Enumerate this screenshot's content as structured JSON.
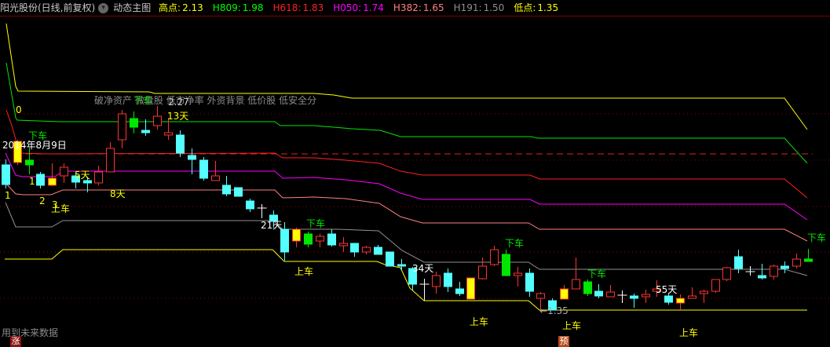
{
  "header": {
    "stock_title": "阳光股份(日线,前复权)",
    "indicator_name": "动态主图",
    "dropdown_icon": "chevron-down-icon",
    "levels": [
      {
        "label": "高点:",
        "value": "2.13",
        "color": "#ffff00"
      },
      {
        "label": "H809:",
        "value": "1.98",
        "color": "#00ff00"
      },
      {
        "label": "H618:",
        "value": "1.83",
        "color": "#ff2020"
      },
      {
        "label": "H050:",
        "value": "1.74",
        "color": "#ff00ff"
      },
      {
        "label": "H382:",
        "value": "1.65",
        "color": "#ff8080"
      },
      {
        "label": "H191:",
        "value": "1.50",
        "color": "#909090"
      },
      {
        "label": "低点:",
        "value": "1.35",
        "color": "#ffff00"
      }
    ]
  },
  "chart_data": {
    "type": "candlestick",
    "high": 2.13,
    "low": 1.35,
    "candles": [
      [
        "down",
        1.905,
        1.83,
        1.926,
        1.815
      ],
      [
        "yellow",
        1.914,
        1.995,
        2.001,
        1.905
      ],
      [
        "green",
        1.923,
        1.905,
        1.971,
        1.869
      ],
      [
        "down",
        1.869,
        1.827,
        1.878,
        1.815
      ],
      [
        "yellow",
        1.827,
        1.854,
        1.911,
        1.824
      ],
      [
        "up",
        1.863,
        1.896,
        1.911,
        1.836
      ],
      [
        "down",
        1.863,
        1.839,
        1.875,
        1.815
      ],
      [
        "down",
        1.845,
        1.836,
        1.86,
        1.8
      ],
      [
        "up",
        1.836,
        1.878,
        1.902,
        1.827
      ],
      [
        "up",
        1.878,
        1.968,
        1.992,
        1.878
      ],
      [
        "up",
        2.001,
        2.1,
        2.115,
        1.968
      ],
      [
        "green",
        2.082,
        2.049,
        2.109,
        2.025
      ],
      [
        "down",
        2.037,
        2.028,
        2.079,
        2.016
      ],
      [
        "up",
        2.055,
        2.091,
        2.13,
        2.04
      ],
      [
        "up",
        2.019,
        2.028,
        2.085,
        2.001
      ],
      [
        "down",
        2.019,
        1.95,
        2.037,
        1.935
      ],
      [
        "down",
        1.941,
        1.926,
        1.968,
        1.869
      ],
      [
        "down",
        1.923,
        1.854,
        1.935,
        1.845
      ],
      [
        "up",
        1.845,
        1.863,
        1.92,
        1.845
      ],
      [
        "down",
        1.827,
        1.794,
        1.863,
        1.785
      ],
      [
        "down",
        1.818,
        1.785,
        1.818,
        1.785
      ],
      [
        "down",
        1.767,
        1.737,
        1.776,
        1.725
      ],
      [
        "cross",
        1.74,
        1.74,
        1.755,
        1.701
      ],
      [
        "down",
        1.713,
        1.689,
        1.731,
        1.665
      ],
      [
        "down",
        1.659,
        1.572,
        1.686,
        1.539
      ],
      [
        "yellow",
        1.614,
        1.659,
        1.665,
        1.59
      ],
      [
        "green",
        1.641,
        1.602,
        1.65,
        1.59
      ],
      [
        "up",
        1.614,
        1.632,
        1.641,
        1.59
      ],
      [
        "down",
        1.641,
        1.599,
        1.659,
        1.593
      ],
      [
        "up",
        1.596,
        1.605,
        1.629,
        1.572
      ],
      [
        "down",
        1.605,
        1.572,
        1.605,
        1.554
      ],
      [
        "up",
        1.572,
        1.59,
        1.596,
        1.563
      ],
      [
        "down",
        1.59,
        1.563,
        1.599,
        1.563
      ],
      [
        "down",
        1.572,
        1.518,
        1.572,
        1.518
      ],
      [
        "down",
        1.524,
        1.518,
        1.545,
        1.5
      ],
      [
        "down",
        1.509,
        1.449,
        1.515,
        1.425
      ],
      [
        "cross",
        1.449,
        1.449,
        1.47,
        1.386
      ],
      [
        "up",
        1.44,
        1.482,
        1.497,
        1.413
      ],
      [
        "down",
        1.491,
        1.44,
        1.509,
        1.419
      ],
      [
        "down",
        1.431,
        1.413,
        1.458,
        1.404
      ],
      [
        "yellow",
        1.392,
        1.473,
        1.473,
        1.392
      ],
      [
        "up",
        1.47,
        1.518,
        1.551,
        1.467
      ],
      [
        "up",
        1.524,
        1.581,
        1.596,
        1.518
      ],
      [
        "green",
        1.563,
        1.482,
        1.581,
        1.479
      ],
      [
        "up",
        1.482,
        1.491,
        1.515,
        1.44
      ],
      [
        "down",
        1.491,
        1.422,
        1.509,
        1.401
      ],
      [
        "up",
        1.395,
        1.413,
        1.419,
        1.35
      ],
      [
        "down",
        1.386,
        1.35,
        1.395,
        1.35
      ],
      [
        "yellow",
        1.392,
        1.431,
        1.446,
        1.392
      ],
      [
        "up",
        1.431,
        1.467,
        1.551,
        1.431
      ],
      [
        "green",
        1.458,
        1.413,
        1.467,
        1.404
      ],
      [
        "down",
        1.422,
        1.404,
        1.449,
        1.395
      ],
      [
        "up",
        1.401,
        1.419,
        1.446,
        1.401
      ],
      [
        "cross",
        1.407,
        1.407,
        1.425,
        1.377
      ],
      [
        "down",
        1.404,
        1.395,
        1.413,
        1.359
      ],
      [
        "up",
        1.401,
        1.41,
        1.428,
        1.377
      ],
      [
        "up",
        1.422,
        1.431,
        1.464,
        1.401
      ],
      [
        "down",
        1.404,
        1.38,
        1.413,
        1.371
      ],
      [
        "yellow",
        1.377,
        1.395,
        1.41,
        1.35
      ],
      [
        "up",
        1.395,
        1.404,
        1.437,
        1.395
      ],
      [
        "up",
        1.413,
        1.422,
        1.428,
        1.377
      ],
      [
        "up",
        1.422,
        1.467,
        1.467,
        1.416
      ],
      [
        "up",
        1.467,
        1.512,
        1.515,
        1.461
      ],
      [
        "down",
        1.554,
        1.509,
        1.581,
        1.491
      ],
      [
        "cross",
        1.497,
        1.497,
        1.518,
        1.482
      ],
      [
        "down",
        1.482,
        1.473,
        1.527,
        1.467
      ],
      [
        "up",
        1.479,
        1.518,
        1.524,
        1.467
      ],
      [
        "down",
        1.518,
        1.509,
        1.536,
        1.491
      ],
      [
        "up",
        1.518,
        1.545,
        1.566,
        1.509
      ],
      [
        "green",
        1.545,
        1.536,
        1.584,
        1.536
      ]
    ],
    "colors": {
      "down": "#54ffff",
      "up": "#ff3232",
      "yellow": "#ffff00",
      "green": "#00e600",
      "cross": "#ffffff"
    }
  },
  "annotations": {
    "tags": "破净资产 微盘股 低市净率 外资背景 低价股 低安全分",
    "date": "2014年8月9日",
    "zero": "0",
    "sell": "下车",
    "buy": "上车",
    "n1": "1",
    "n2": "2",
    "n3": "3",
    "d5": "5天",
    "d8": "8天",
    "d13": "13天",
    "d21": "21天",
    "d34": "34天",
    "d55": "55天",
    "price_high": "2.27",
    "price_low": "1.35",
    "future_data": "用到未来数据",
    "badge_rise": "涨",
    "badge_forecast": "预"
  }
}
